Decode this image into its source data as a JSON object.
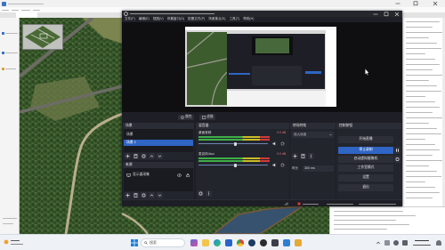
{
  "obs": {
    "menu": [
      "文件(F)",
      "编辑(E)",
      "视图(V)",
      "停靠窗口(D)",
      "配置文件(P)",
      "场景集合(S)",
      "工具(T)",
      "帮助(H)"
    ],
    "preview": {
      "properties_label": "属性",
      "filters_label": "滤镜"
    },
    "scenes": {
      "title": "场景",
      "items": [
        "场景",
        "场景 2"
      ],
      "selected_index": 1
    },
    "sources": {
      "title": "来源",
      "items": [
        "显示器采集"
      ]
    },
    "mixer": {
      "title": "混音器",
      "channels": [
        {
          "name": "桌面音频",
          "level": "0.0 dB"
        },
        {
          "name": "麦克风/Aux",
          "level": "0.0 dB"
        }
      ]
    },
    "transitions": {
      "title": "转场特效",
      "current": "淡入淡出",
      "duration_label": "时长",
      "duration": "300 ms"
    },
    "controls": {
      "title": "控制按钮",
      "start_streaming": "开始直播",
      "stop_recording": "停止录制",
      "start_virtual_camera": "启动虚拟摄像机",
      "studio_mode": "工作室模式",
      "settings": "设置",
      "exit": "退出"
    }
  },
  "taskbar": {
    "search_placeholder": "搜索"
  },
  "icons": [
    "minimize-icon",
    "maximize-icon",
    "close-icon",
    "obs-logo-icon",
    "gear-icon",
    "filter-icon",
    "plus-icon",
    "trash-icon",
    "chevron-up-icon",
    "chevron-down-icon",
    "eye-icon",
    "lock-icon",
    "monitor-icon",
    "speaker-icon",
    "pause-icon",
    "dots-icon",
    "record-dot-icon",
    "windows-start-icon",
    "search-icon",
    "weather-icon",
    "cursor-icon"
  ],
  "colors": {
    "obs_background": "#1e1f26",
    "accent_selected": "#2f65c4",
    "meter_green": "#3fae49",
    "meter_yellow": "#c9bd25",
    "meter_red": "#d03a3a",
    "forest": "#3a5a2c",
    "road": "#6c6c64",
    "dirt_path": "#b9ae8c",
    "river": "#36526e",
    "taskbar": "#eef1f6"
  }
}
